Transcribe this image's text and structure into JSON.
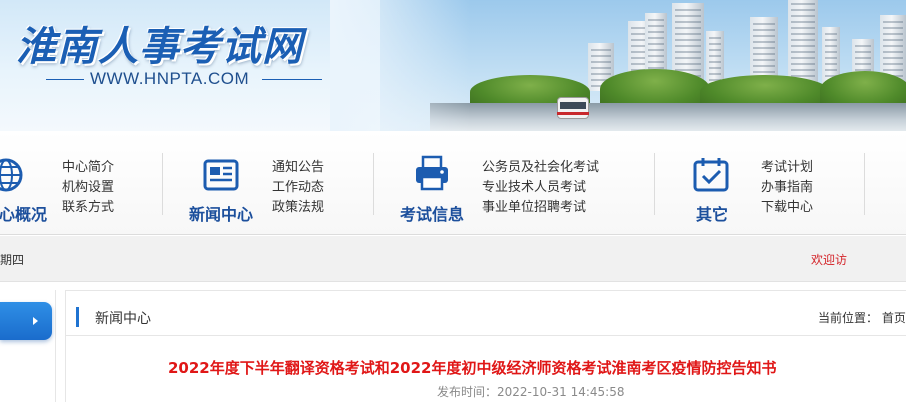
{
  "header": {
    "logo_text": "淮南人事考试网",
    "site_url": "WWW.HNPTA.COM"
  },
  "nav": {
    "blocks": [
      {
        "title": "心概况",
        "icon": "globe-icon",
        "links": [
          "中心简介",
          "机构设置",
          "联系方式"
        ]
      },
      {
        "title": "新闻中心",
        "icon": "newspaper-icon",
        "links": [
          "通知公告",
          "工作动态",
          "政策法规"
        ]
      },
      {
        "title": "考试信息",
        "icon": "printer-icon",
        "links": [
          "公务员及社会化考试",
          "专业技术人员考试",
          "事业单位招聘考试"
        ]
      },
      {
        "title": "其它",
        "icon": "calendar-check-icon",
        "links": [
          "考试计划",
          "办事指南",
          "下载中心"
        ]
      }
    ]
  },
  "datebar": {
    "date_text": "期四",
    "welcome": "欢迎访"
  },
  "content": {
    "section_title": "新闻中心",
    "breadcrumb": "当前位置：  首页",
    "article_title": "2022年度下半年翻译资格考试和2022年度初中级经济师资格考试淮南考区疫情防控告知书",
    "publish_label": "发布时间：",
    "publish_time": "2022-10-31 14:45:58"
  },
  "colors": {
    "brand_blue": "#1c4f9c",
    "title_red": "#e01717",
    "accent_blue": "#1f73d1"
  }
}
